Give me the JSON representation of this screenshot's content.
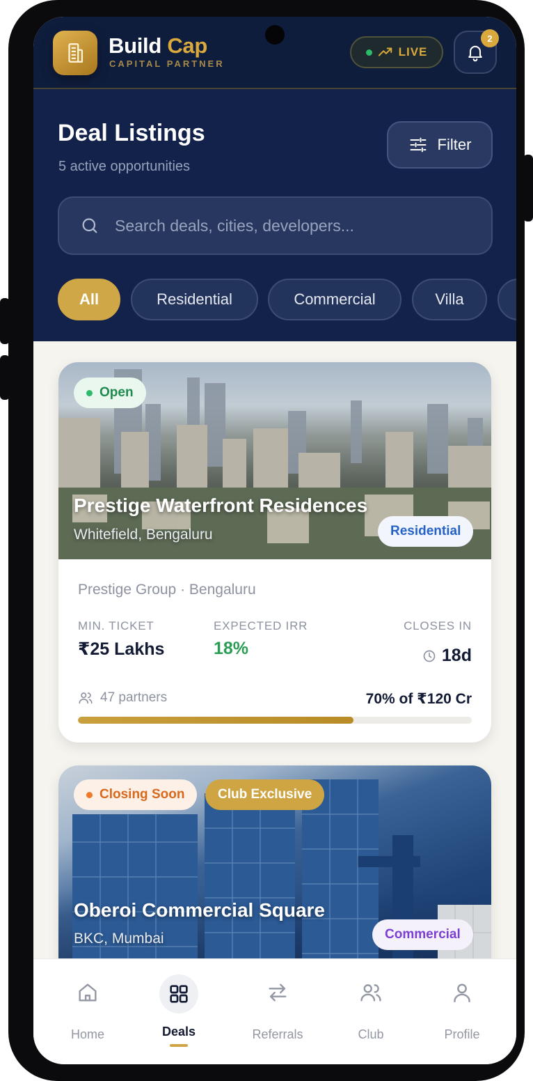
{
  "header": {
    "brand_name_1": "Build",
    "brand_name_2": "Cap",
    "brand_subtitle": "CAPITAL PARTNER",
    "live_label": "LIVE",
    "notification_count": "2"
  },
  "page": {
    "title": "Deal Listings",
    "subtitle": "5 active opportunities",
    "filter_label": "Filter"
  },
  "search": {
    "placeholder": "Search deals, cities, developers..."
  },
  "categories": [
    "All",
    "Residential",
    "Commercial",
    "Villa"
  ],
  "deals": [
    {
      "status": "Open",
      "title": "Prestige Waterfront Residences",
      "location": "Whitefield, Bengaluru",
      "type": "Residential",
      "developer": "Prestige Group · Bengaluru",
      "min_ticket_label": "MIN. TICKET",
      "min_ticket": "₹25 Lakhs",
      "irr_label": "EXPECTED IRR",
      "irr": "18%",
      "closes_label": "CLOSES IN",
      "closes_in": "18d",
      "partners": "47 partners",
      "raised": "70% of ₹120 Cr",
      "progress": 0.7
    },
    {
      "status": "Closing Soon",
      "tag": "Club Exclusive",
      "title": "Oberoi Commercial Square",
      "location": "BKC, Mumbai",
      "type": "Commercial"
    }
  ],
  "nav": {
    "items": [
      "Home",
      "Deals",
      "Referrals",
      "Club",
      "Profile"
    ],
    "active": "Deals"
  },
  "colors": {
    "navy": "#13224a",
    "gold": "#d0a746",
    "open_green": "#1f8a4d",
    "irr_green": "#2a9d55",
    "closing_orange": "#d8691c",
    "residential_blue": "#2563c9",
    "commercial_purple": "#7b3fd1"
  }
}
